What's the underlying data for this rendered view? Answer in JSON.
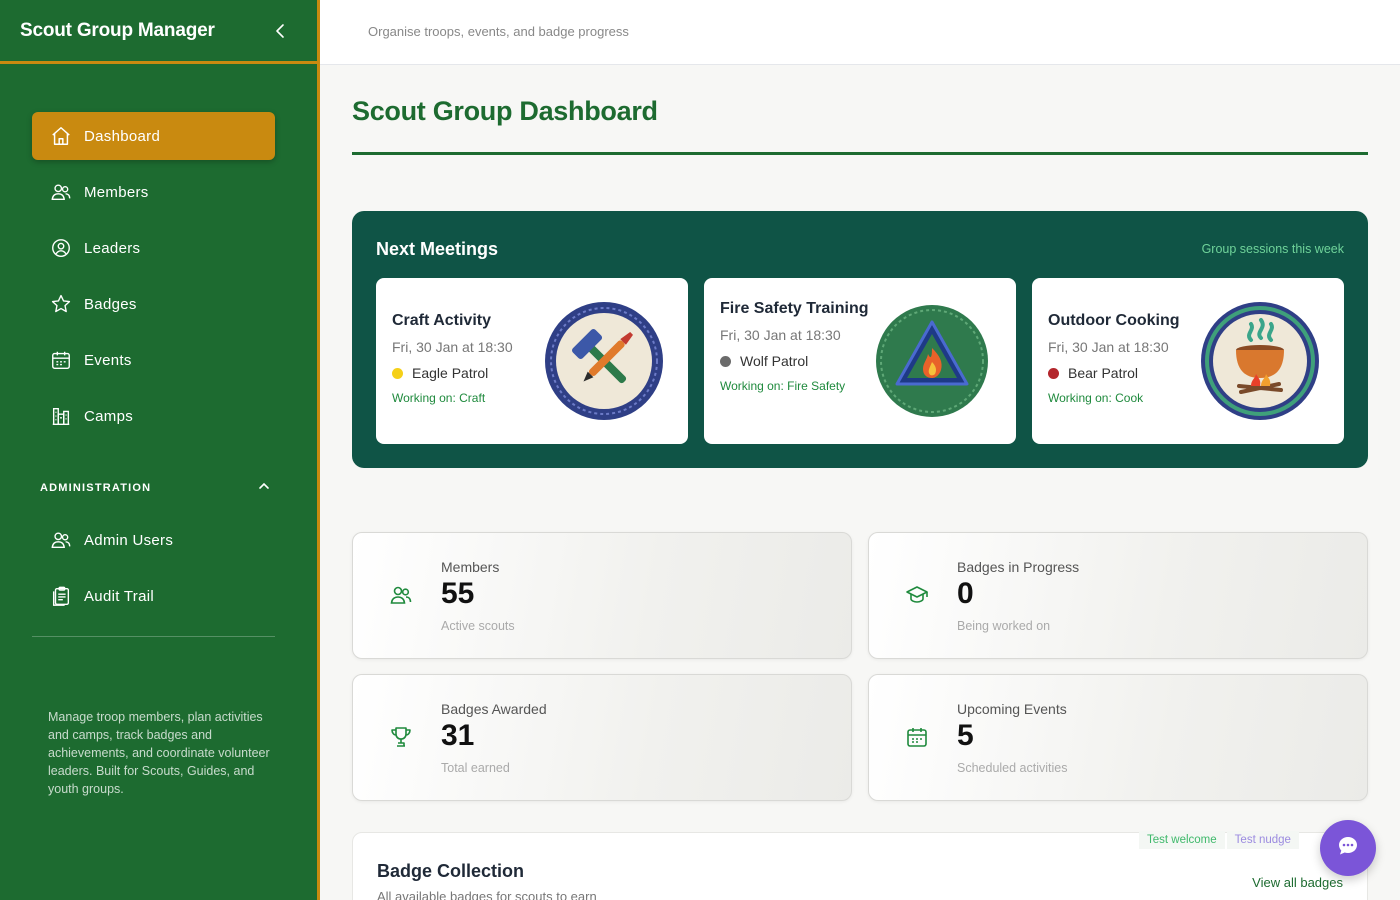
{
  "app": {
    "title": "Scout Group Manager"
  },
  "topbar": {
    "subtitle": "Organise troops, events, and badge progress"
  },
  "sidebar": {
    "items": [
      {
        "label": "Dashboard",
        "icon": "home-icon",
        "active": true
      },
      {
        "label": "Members",
        "icon": "users-icon"
      },
      {
        "label": "Leaders",
        "icon": "user-circle-icon"
      },
      {
        "label": "Badges",
        "icon": "star-icon"
      },
      {
        "label": "Events",
        "icon": "calendar-icon"
      },
      {
        "label": "Camps",
        "icon": "building-icon"
      }
    ],
    "admin_heading": "ADMINISTRATION",
    "admin_items": [
      {
        "label": "Admin Users",
        "icon": "users-icon"
      },
      {
        "label": "Audit Trail",
        "icon": "clipboard-icon"
      }
    ],
    "description": "Manage troop members, plan activities and camps, track badges and achievements, and coordinate volunteer leaders. Built for Scouts, Guides, and youth groups."
  },
  "page": {
    "title": "Scout Group Dashboard"
  },
  "meetings": {
    "title": "Next Meetings",
    "hint": "Group sessions this week",
    "cards": [
      {
        "name": "Craft Activity",
        "time": "Fri, 30 Jan at 18:30",
        "patrol": "Eagle Patrol",
        "patrol_color": "#f5d018",
        "working": "Working on: Craft",
        "badge_icon": "hammer-brush-badge-icon"
      },
      {
        "name": "Fire Safety Training",
        "time": "Fri, 30 Jan at 18:30",
        "patrol": "Wolf Patrol",
        "patrol_color": "#6b6b6b",
        "working": "Working on: Fire Safety",
        "badge_icon": "fire-triangle-badge-icon"
      },
      {
        "name": "Outdoor Cooking",
        "time": "Fri, 30 Jan at 18:30",
        "patrol": "Bear Patrol",
        "patrol_color": "#b3262c",
        "working": "Working on: Cook",
        "badge_icon": "cooking-pot-badge-icon"
      }
    ]
  },
  "stats": [
    {
      "label": "Members",
      "value": "55",
      "sub": "Active scouts",
      "icon": "users-icon"
    },
    {
      "label": "Badges in Progress",
      "value": "0",
      "sub": "Being worked on",
      "icon": "graduation-cap-icon"
    },
    {
      "label": "Badges Awarded",
      "value": "31",
      "sub": "Total earned",
      "icon": "trophy-icon"
    },
    {
      "label": "Upcoming Events",
      "value": "5",
      "sub": "Scheduled activities",
      "icon": "calendar-icon"
    }
  ],
  "collection": {
    "title": "Badge Collection",
    "subtitle": "All available badges for scouts to earn",
    "link": "View all badges"
  },
  "test_buttons": {
    "welcome": "Test welcome",
    "nudge": "Test nudge"
  },
  "colors": {
    "primary": "#1d6b30",
    "accent": "#c98a10",
    "meetings_bg": "#0f5446",
    "chat": "#7b55d8"
  }
}
